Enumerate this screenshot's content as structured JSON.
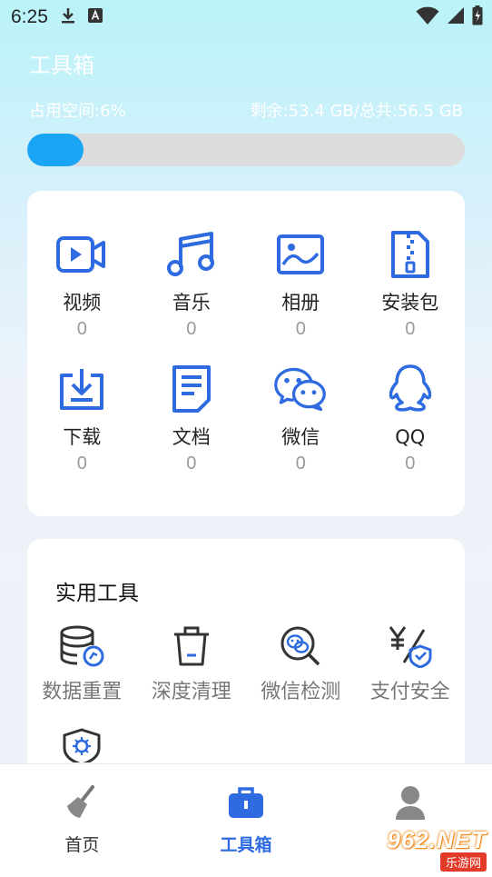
{
  "status_bar": {
    "time": "6:25"
  },
  "header": {
    "title": "工具箱",
    "storage_used": "占用空间:6%",
    "storage_remaining": "剩余:53.4 GB/总共:56.5 GB",
    "progress_percent": 6
  },
  "categories": [
    {
      "label": "视频",
      "count": "0",
      "icon": "video-icon"
    },
    {
      "label": "音乐",
      "count": "0",
      "icon": "music-icon"
    },
    {
      "label": "相册",
      "count": "0",
      "icon": "photo-album-icon"
    },
    {
      "label": "安装包",
      "count": "0",
      "icon": "package-icon"
    },
    {
      "label": "下载",
      "count": "0",
      "icon": "download-icon"
    },
    {
      "label": "文档",
      "count": "0",
      "icon": "document-icon"
    },
    {
      "label": "微信",
      "count": "0",
      "icon": "wechat-icon"
    },
    {
      "label": "QQ",
      "count": "0",
      "icon": "qq-icon"
    }
  ],
  "tools": {
    "title": "实用工具",
    "items": [
      {
        "label": "数据重置",
        "icon": "database-reset-icon"
      },
      {
        "label": "深度清理",
        "icon": "trash-icon"
      },
      {
        "label": "微信检测",
        "icon": "wechat-scan-icon"
      },
      {
        "label": "支付安全",
        "icon": "payment-shield-icon"
      }
    ],
    "extra_icon": "virus-shield-icon"
  },
  "bottom_nav": [
    {
      "label": "首页",
      "icon": "broom-icon"
    },
    {
      "label": "工具箱",
      "icon": "toolbox-icon",
      "active": true
    },
    {
      "label": "",
      "icon": "user-icon"
    }
  ],
  "watermark": {
    "main": "962.NET",
    "sub": "乐游网"
  },
  "colors": {
    "accent": "#2f6be0",
    "progress": "#19a5f4",
    "icon_blue": "#2f6be0"
  }
}
